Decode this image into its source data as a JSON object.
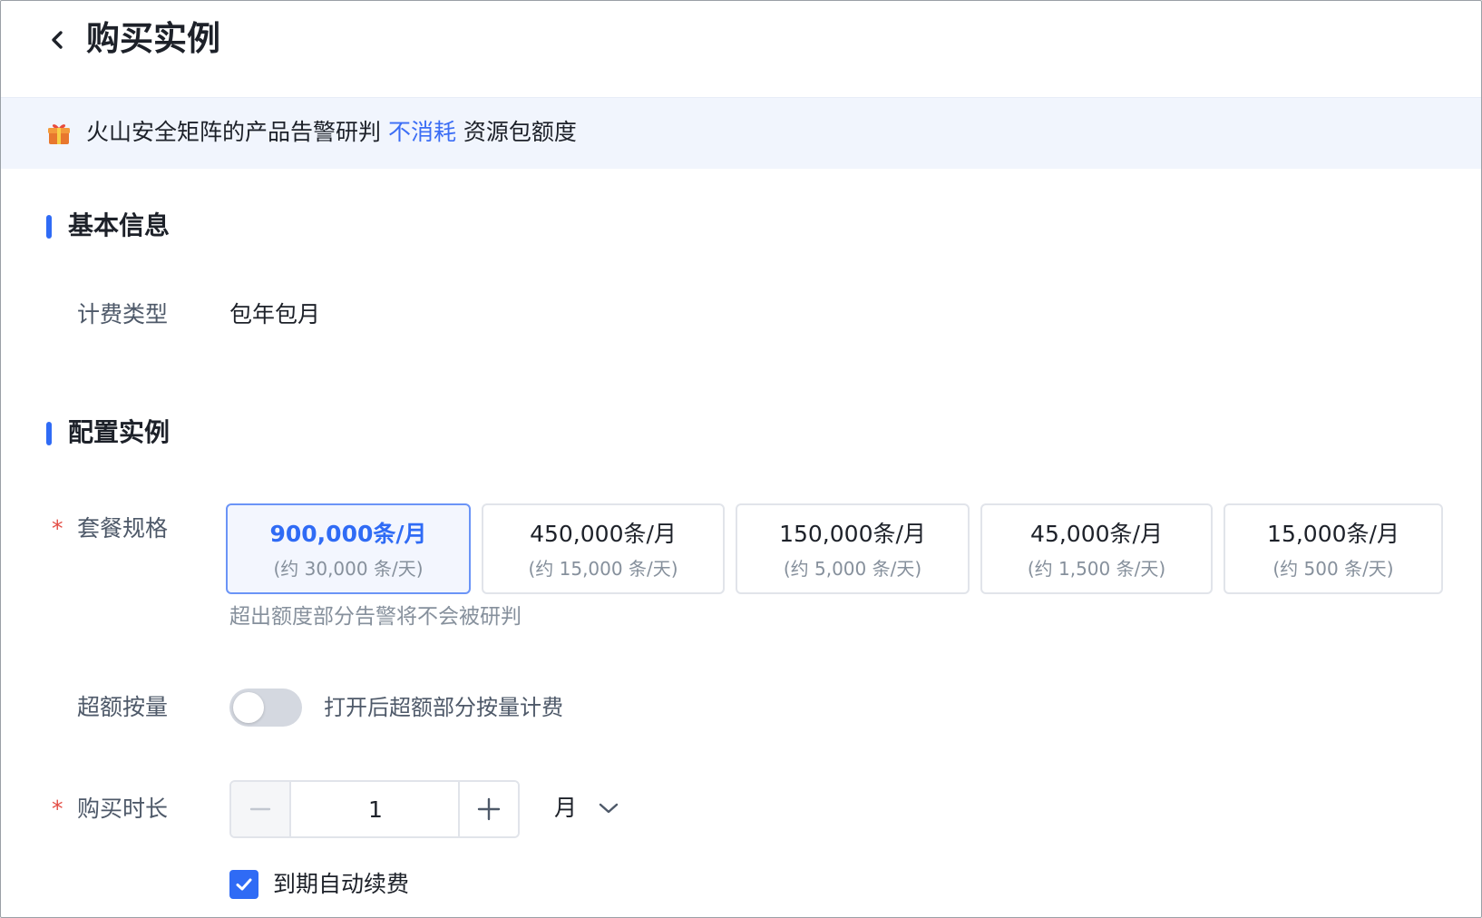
{
  "header": {
    "title": "购买实例"
  },
  "banner": {
    "text_before": "火山安全矩阵的产品告警研判 ",
    "highlight": "不消耗",
    "text_after": " 资源包额度"
  },
  "basic_info": {
    "section_title": "基本信息",
    "billing_type_label": "计费类型",
    "billing_type_value": "包年包月"
  },
  "config": {
    "section_title": "配置实例",
    "plan_label": "套餐规格",
    "plans": [
      {
        "main": "900,000条/月",
        "sub": "(约 30,000 条/天)",
        "selected": true
      },
      {
        "main": "450,000条/月",
        "sub": "(约 15,000 条/天)",
        "selected": false
      },
      {
        "main": "150,000条/月",
        "sub": "(约 5,000 条/天)",
        "selected": false
      },
      {
        "main": "45,000条/月",
        "sub": "(约 1,500 条/天)",
        "selected": false
      },
      {
        "main": "15,000条/月",
        "sub": "(约 500 条/天)",
        "selected": false
      }
    ],
    "plan_hint": "超出额度部分告警将不会被研判",
    "overage_label": "超额按量",
    "overage_enabled": false,
    "overage_hint": "打开后超额部分按量计费",
    "duration_label": "购买时长",
    "duration_value": "1",
    "duration_unit": "月",
    "auto_renew_checked": true,
    "auto_renew_label": "到期自动续费"
  },
  "colors": {
    "accent": "#2f6bf5",
    "required": "#e34d45",
    "banner_bg": "#f1f5fd"
  }
}
